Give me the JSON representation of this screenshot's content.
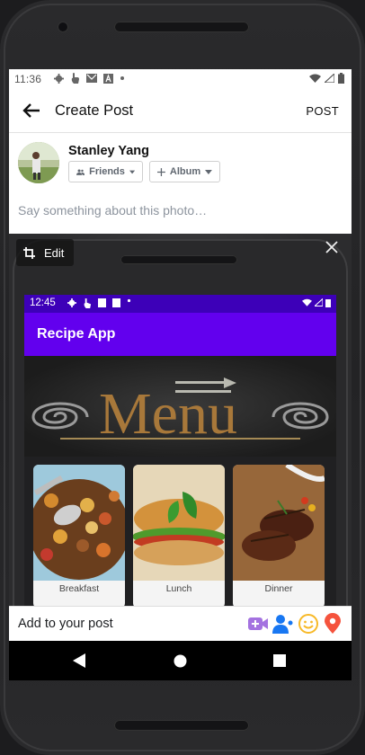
{
  "status_bar": {
    "time": "11:36",
    "icons": [
      "gear-icon",
      "touch-icon",
      "gmail-icon",
      "a-icon",
      "dot-icon"
    ],
    "right_icons": [
      "wifi-icon",
      "signal-icon",
      "battery-icon"
    ]
  },
  "app_bar": {
    "title": "Create Post",
    "action": "POST"
  },
  "composer": {
    "user_name": "Stanley Yang",
    "audience": "Friends",
    "album": "Album",
    "placeholder": "Say something about this photo…"
  },
  "photo": {
    "edit_label": "Edit",
    "inner_app": {
      "time": "12:45",
      "title": "Recipe App",
      "banner_text": "Menu",
      "cards": [
        {
          "label": "Breakfast"
        },
        {
          "label": "Lunch"
        },
        {
          "label": "Dinner"
        }
      ]
    }
  },
  "add_bar": {
    "label": "Add to your post"
  },
  "colors": {
    "accent_purple": "#6200ee",
    "video_purple": "#a472e0",
    "tag_blue": "#1877f2",
    "feeling_yellow": "#f7b928",
    "location_red": "#f5533d"
  }
}
